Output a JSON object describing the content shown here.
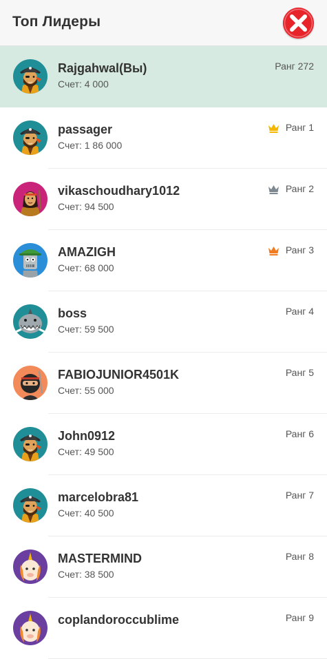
{
  "header": {
    "title": "Топ Лидеры",
    "close_icon": "close-icon"
  },
  "colors": {
    "current_user_row": "#d6eae1",
    "close_button": "#e8242b",
    "crown_gold": "#f5b800",
    "crown_silver": "#7d8890",
    "crown_bronze": "#f07c1f"
  },
  "current_user": {
    "name": "Rajgahwal(Вы)",
    "score": "Счет: 4 000",
    "rank": "Ранг 272",
    "avatar": "pirate-avatar"
  },
  "players": [
    {
      "name": "passager",
      "score": "Счет: 1 86 000",
      "rank": "Ранг 1",
      "crown": "gold",
      "avatar": "pirate-avatar"
    },
    {
      "name": "vikaschoudhary1012",
      "score": "Счет: 94 500",
      "rank": "Ранг 2",
      "crown": "silver",
      "avatar": "warrior-avatar"
    },
    {
      "name": "AMAZIGH",
      "score": "Счет: 68 000",
      "rank": "Ранг 3",
      "crown": "bronze",
      "avatar": "robot-avatar"
    },
    {
      "name": "boss",
      "score": "Счет: 59 500",
      "rank": "Ранг 4",
      "crown": "",
      "avatar": "shark-avatar"
    },
    {
      "name": "FABIOJUNIOR4501K",
      "score": "Счет: 55 000",
      "rank": "Ранг 5",
      "crown": "",
      "avatar": "ninja-avatar"
    },
    {
      "name": "John0912",
      "score": "Счет: 49 500",
      "rank": "Ранг 6",
      "crown": "",
      "avatar": "pirate-avatar"
    },
    {
      "name": "marcelobra81",
      "score": "Счет: 40 500",
      "rank": "Ранг 7",
      "crown": "",
      "avatar": "pirate-avatar"
    },
    {
      "name": "MASTERMIND",
      "score": "Счет: 38 500",
      "rank": "Ранг 8",
      "crown": "",
      "avatar": "unicorn-avatar"
    },
    {
      "name": "coplandoroccublime",
      "score": "",
      "rank": "Ранг 9",
      "crown": "",
      "avatar": "unicorn-avatar"
    }
  ]
}
